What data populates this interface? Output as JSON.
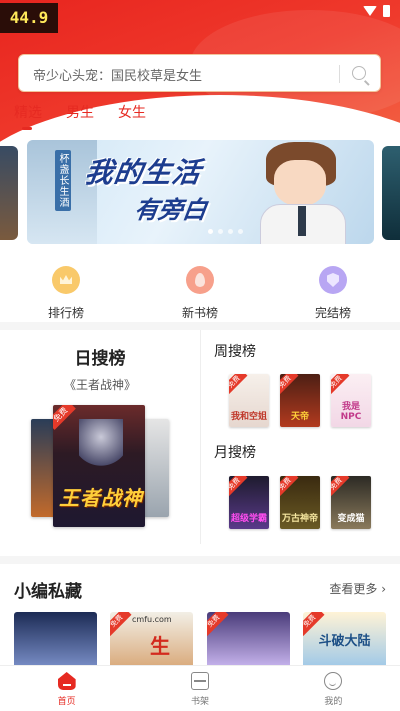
{
  "status_bar": {
    "fps": "44.9"
  },
  "search": {
    "placeholder": "帝少心头宠：国民校草是女生"
  },
  "tabs": [
    {
      "label": "精选",
      "active": true
    },
    {
      "label": "男生",
      "active": false
    },
    {
      "label": "女生",
      "active": false
    }
  ],
  "banner": {
    "vertical_text": "杯盏长生酒",
    "title_line1": "我的生活",
    "title_line2": "有旁白",
    "page_count": 4,
    "active_index": 0
  },
  "quick_menu": [
    {
      "label": "排行榜",
      "icon": "crown-icon",
      "color": "#f9c96a"
    },
    {
      "label": "新书榜",
      "icon": "flame-icon",
      "color": "#f7a08b"
    },
    {
      "label": "完结榜",
      "icon": "shield-check-icon",
      "color": "#b8a6f3"
    }
  ],
  "rankings": {
    "daily": {
      "title": "日搜榜",
      "featured_book": "《王者战神》",
      "cover_text": "王者战神",
      "free_tag": "免费"
    },
    "weekly": {
      "title": "周搜榜",
      "covers": [
        {
          "text": "我和空姐",
          "free_tag": "免费"
        },
        {
          "text": "天帝",
          "free_tag": "免费"
        },
        {
          "text": "我是NPC",
          "free_tag": "免费"
        }
      ]
    },
    "monthly": {
      "title": "月搜榜",
      "covers": [
        {
          "text": "超级学霸",
          "free_tag": "免费"
        },
        {
          "text": "万古神帝",
          "free_tag": "免费"
        },
        {
          "text": "变成猫",
          "free_tag": "免费"
        }
      ]
    }
  },
  "editor_picks": {
    "title": "小编私藏",
    "more_label": "查看更多",
    "more_icon": "chevron-right-icon",
    "items": [
      {
        "text": "",
        "site": "",
        "free_tag": ""
      },
      {
        "text": "生",
        "site": "cmfu.com",
        "free_tag": "免费"
      },
      {
        "text": "",
        "site": "",
        "free_tag": "免费"
      },
      {
        "text": "斗破大陆",
        "site": "",
        "free_tag": "免费"
      }
    ]
  },
  "bottom_nav": [
    {
      "label": "首页",
      "icon": "home-icon",
      "active": true
    },
    {
      "label": "书架",
      "icon": "bookshelf-icon",
      "active": false
    },
    {
      "label": "我的",
      "icon": "profile-icon",
      "active": false
    }
  ],
  "colors": {
    "accent": "#e62a22",
    "header_gradient_start": "#e8251f",
    "header_gradient_end": "#f6845e"
  }
}
